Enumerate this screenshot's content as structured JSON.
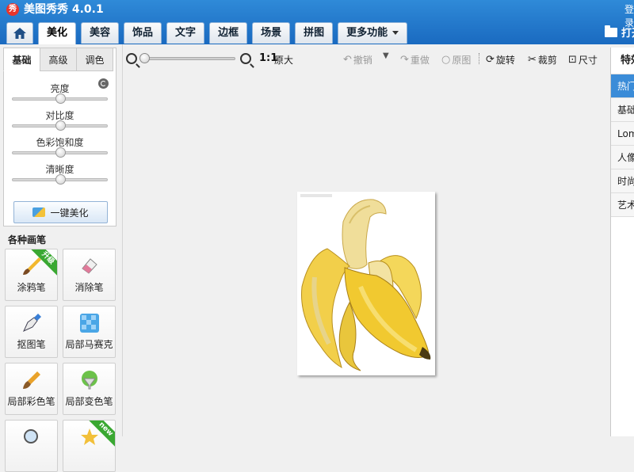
{
  "app": {
    "title": "美图秀秀 4.0.1",
    "logo_text": "秀",
    "login_text": "登录"
  },
  "tabs": [
    {
      "label": "美化",
      "active": true
    },
    {
      "label": "美容"
    },
    {
      "label": "饰品"
    },
    {
      "label": "文字"
    },
    {
      "label": "边框"
    },
    {
      "label": "场景"
    },
    {
      "label": "拼图"
    },
    {
      "label": "更多功能"
    }
  ],
  "open_label": "打开",
  "adjust": {
    "subtabs": [
      "基础",
      "高级",
      "调色"
    ],
    "sliders": [
      {
        "label": "亮度",
        "value": 0.5
      },
      {
        "label": "对比度",
        "value": 0.5
      },
      {
        "label": "色彩饱和度",
        "value": 0.5
      },
      {
        "label": "清晰度",
        "value": 0.5
      }
    ],
    "one_click_label": "一键美化"
  },
  "brushes": {
    "title": "各种画笔",
    "items": [
      {
        "label": "涂鸦笔",
        "badge": "升级",
        "badge_color": "#3aa832"
      },
      {
        "label": "消除笔"
      },
      {
        "label": "抠图笔"
      },
      {
        "label": "局部马赛克"
      },
      {
        "label": "局部彩色笔"
      },
      {
        "label": "局部变色笔"
      },
      {
        "label": "",
        "badge": ""
      },
      {
        "label": "",
        "badge": "new",
        "badge_color": "#3aa832"
      }
    ]
  },
  "toolbar": {
    "zoom_value": 0.0,
    "ratio": "1:1",
    "original_size": "原大",
    "undo": "撤销",
    "redo": "重做",
    "original": "原图",
    "rotate": "旋转",
    "crop": "裁剪",
    "size": "尺寸"
  },
  "right_panel": {
    "header": "特效",
    "categories": [
      {
        "label": "热门",
        "active": true
      },
      {
        "label": "基础"
      },
      {
        "label": "Lomo"
      },
      {
        "label": "人像"
      },
      {
        "label": "时尚"
      },
      {
        "label": "艺术"
      }
    ]
  },
  "colors": {
    "accent": "#1a6ac0",
    "banana": "#f1d35a"
  }
}
